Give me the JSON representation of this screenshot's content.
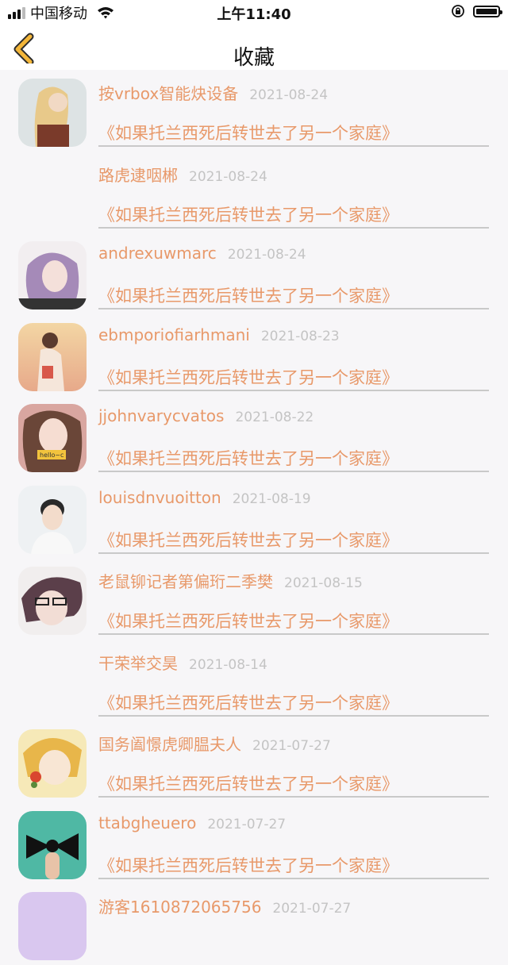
{
  "status_bar": {
    "carrier": "中国移动",
    "time": "上午11:40"
  },
  "header": {
    "title": "收藏"
  },
  "favorites": [
    {
      "name": "按vrbox智能炔设备",
      "date": "2021-08-24",
      "book": "《如果托兰西死后转世去了另一个家庭》",
      "avatar": "blonde-girl"
    },
    {
      "name": "路虎逮咽郴",
      "date": "2021-08-24",
      "book": "《如果托兰西死后转世去了另一个家庭》",
      "avatar": "none"
    },
    {
      "name": "andrexuwmarc",
      "date": "2021-08-24",
      "book": "《如果托兰西死后转世去了另一个家庭》",
      "avatar": "purple-hair"
    },
    {
      "name": "ebmporiofiarhmani",
      "date": "2021-08-23",
      "book": "《如果托兰西死后转世去了另一个家庭》",
      "avatar": "sunset-girl"
    },
    {
      "name": "jjohnvarycvatos",
      "date": "2021-08-22",
      "book": "《如果托兰西死后转世去了另一个家庭》",
      "avatar": "hello-girl"
    },
    {
      "name": "louisdnvuoitton",
      "date": "2021-08-19",
      "book": "《如果托兰西死后转世去了另一个家庭》",
      "avatar": "young-man"
    },
    {
      "name": "老鼠铆记者第偏珩二季樊",
      "date": "2021-08-15",
      "book": "《如果托兰西死后转世去了另一个家庭》",
      "avatar": "anime-glasses"
    },
    {
      "name": "干荣举交昊",
      "date": "2021-08-14",
      "book": "《如果托兰西死后转世去了另一个家庭》",
      "avatar": "none"
    },
    {
      "name": "国务阖憬虎卿腽夫人",
      "date": "2021-07-27",
      "book": "《如果托兰西死后转世去了另一个家庭》",
      "avatar": "anime-flower"
    },
    {
      "name": "ttabgheuero",
      "date": "2021-07-27",
      "book": "《如果托兰西死后转世去了另一个家庭》",
      "avatar": "bow-finger"
    },
    {
      "name": "游客1610872065756",
      "date": "2021-07-27",
      "book": "",
      "avatar": "lavender"
    }
  ]
}
